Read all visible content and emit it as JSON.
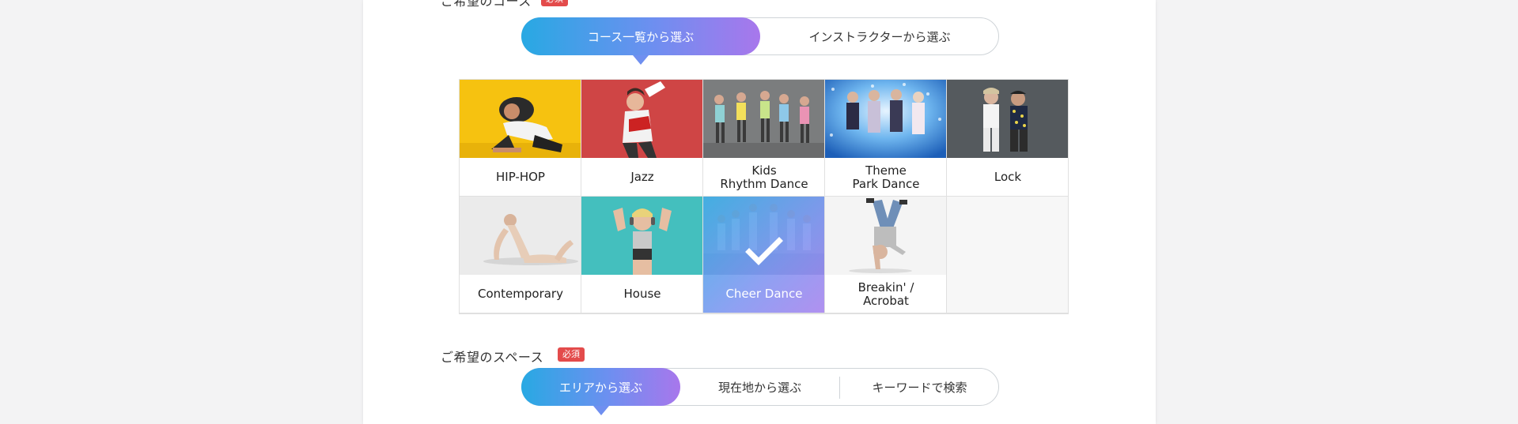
{
  "course_section": {
    "label": "ご希望のコース",
    "required": "必須",
    "tabs": [
      {
        "label": "コース一覧から選ぶ",
        "active": true
      },
      {
        "label": "インストラクターから選ぶ",
        "active": false
      }
    ],
    "courses": [
      {
        "label": "HIP-HOP",
        "selected": false
      },
      {
        "label": "Jazz",
        "selected": false
      },
      {
        "label": "Kids\nRhythm Dance",
        "selected": false
      },
      {
        "label": "Theme\nPark Dance",
        "selected": false
      },
      {
        "label": "Lock",
        "selected": false
      },
      {
        "label": "Contemporary",
        "selected": false
      },
      {
        "label": "House",
        "selected": false
      },
      {
        "label": "Cheer Dance",
        "selected": true
      },
      {
        "label": "Breakin' /\nAcrobat",
        "selected": false
      }
    ]
  },
  "space_section": {
    "label": "ご希望のスペース",
    "required": "必須",
    "tabs": [
      {
        "label": "エリアから選ぶ",
        "active": true
      },
      {
        "label": "現在地から選ぶ",
        "active": false
      },
      {
        "label": "キーワードで検索",
        "active": false
      }
    ]
  },
  "colors": {
    "accent_start": "#28a9e3",
    "accent_end": "#a877ec",
    "badge": "#e34b4b"
  }
}
